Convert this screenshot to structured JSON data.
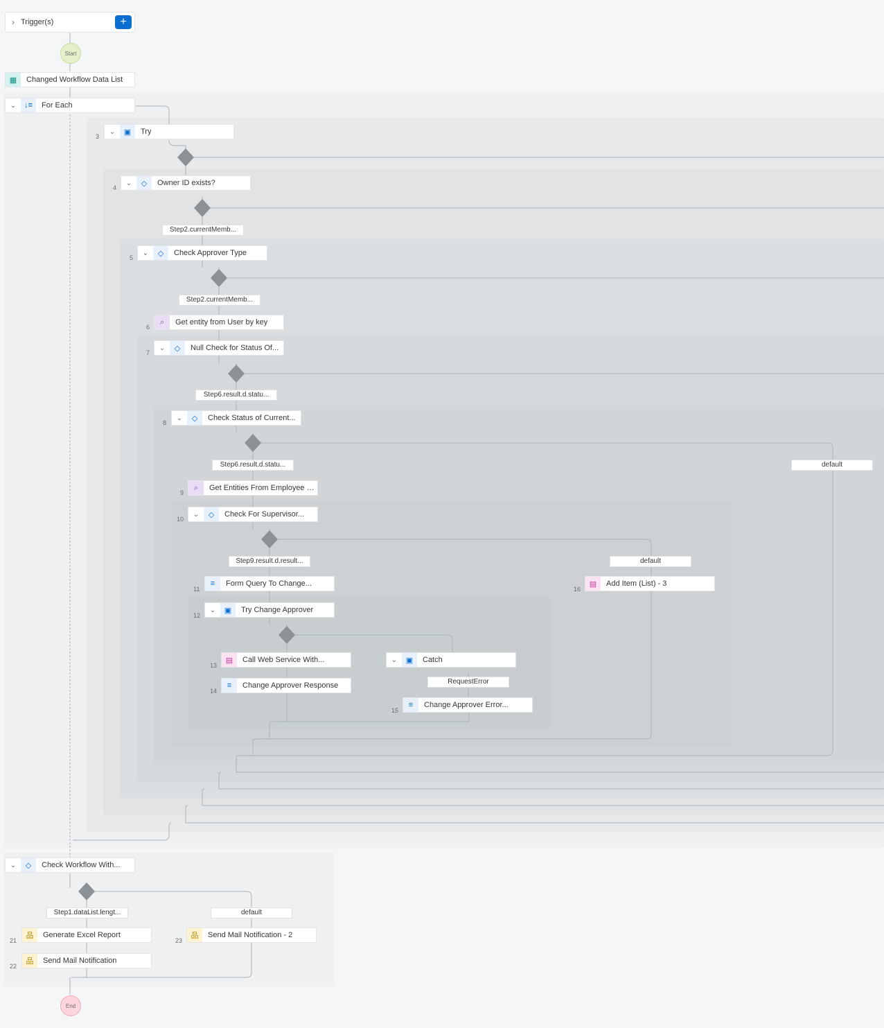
{
  "trigger": {
    "label": "Trigger(s)",
    "add_icon": "plus-icon"
  },
  "start": {
    "label": "Start"
  },
  "end": {
    "label": "End"
  },
  "nodes": {
    "changed_list": "Changed Workflow Data List",
    "for_each": "For Each",
    "try": "Try",
    "owner_id": "Owner ID exists?",
    "check_approver_type": "Check Approver Type",
    "get_entity_user": "Get entity from User by key",
    "null_check": "Null Check for Status Of...",
    "check_status": "Check Status of Current...",
    "get_entities_job": "Get Entities From Employee Job",
    "check_supervisor": "Check For Supervisor...",
    "form_query": "Form Query To Change...",
    "add_item": "Add Item (List) - 3",
    "try_change": "Try Change Approver",
    "call_ws": "Call Web Service With...",
    "catch": "Catch",
    "change_resp": "Change Approver Response",
    "change_err": "Change Approver Error...",
    "check_workflow": "Check Workflow With...",
    "gen_excel": "Generate Excel Report",
    "send_mail": "Send Mail Notification",
    "send_mail2": "Send Mail Notification - 2"
  },
  "numbers": {
    "n3": "3",
    "n4": "4",
    "n5": "5",
    "n6": "6",
    "n7": "7",
    "n8": "8",
    "n9": "9",
    "n10": "10",
    "n11": "11",
    "n12": "12",
    "n13": "13",
    "n14": "14",
    "n15": "15",
    "n16": "16",
    "n21": "21",
    "n22": "22",
    "n23": "23"
  },
  "conditions": {
    "c1": "Step2.currentMemb...",
    "c2": "Step2.currentMemb...",
    "c3": "Step6.result.d.statu...",
    "c4": "Step6.result.d.statu...",
    "c5": "default",
    "c6": "Step9.result.d.result...",
    "c7": "default",
    "c8": "RequestError",
    "c9": "Step1.dataList.lengt...",
    "c10": "default"
  },
  "colors": {
    "accent": "#0a6ed1",
    "line": "#a9b4be",
    "diamond": "#8c9196"
  }
}
